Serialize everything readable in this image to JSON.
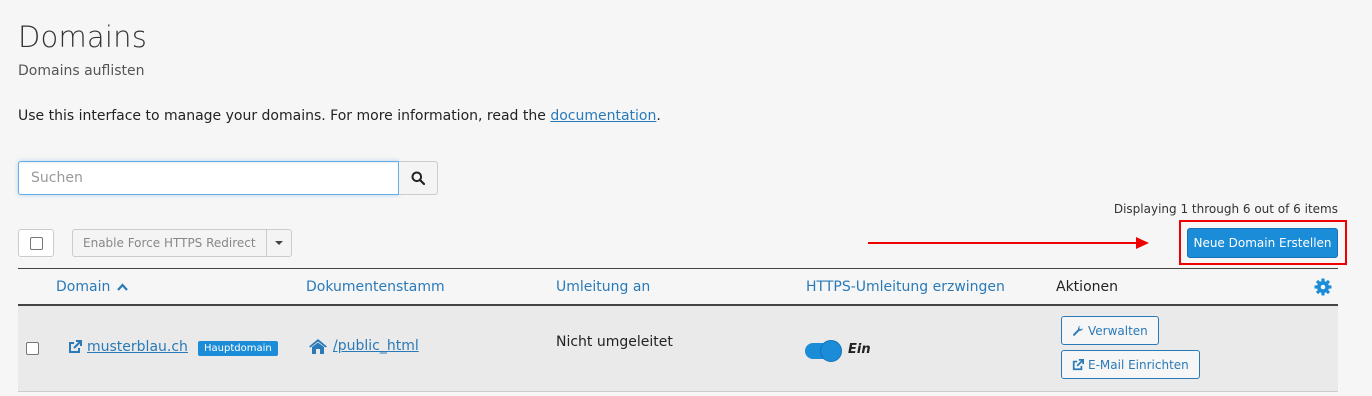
{
  "page": {
    "title": "Domains",
    "subtitle": "Domains auflisten",
    "intro_text": "Use this interface to manage your domains. For more information, read the ",
    "intro_link": "documentation",
    "intro_end": "."
  },
  "search": {
    "placeholder": "Suchen",
    "value": "",
    "button_icon": "search-icon"
  },
  "pagination": {
    "text": "Displaying 1 through 6 out of 6 items"
  },
  "toolbar": {
    "bulk_action_label": "Enable Force HTTPS Redirect",
    "create_button_label": "Neue Domain Erstellen"
  },
  "annotation": {
    "color": "#ee0000"
  },
  "table": {
    "columns": {
      "domain": "Domain",
      "docroot": "Dokumentenstamm",
      "redirect": "Umleitung an",
      "https": "HTTPS-Umleitung erzwingen",
      "actions": "Aktionen"
    },
    "sort_icon": "chevron-up-icon",
    "settings_icon": "gear-icon",
    "rows": [
      {
        "domain": "musterblau.ch",
        "badge": "Hauptdomain",
        "docroot": "/public_html",
        "redirect": "Nicht umgeleitet",
        "https_enabled": true,
        "https_label": "Ein",
        "actions": {
          "manage": "Verwalten",
          "email": "E-Mail Einrichten"
        }
      }
    ]
  },
  "colors": {
    "primary": "#1a8cd8",
    "link": "#2a7ab8",
    "background": "#f6f6f6"
  }
}
